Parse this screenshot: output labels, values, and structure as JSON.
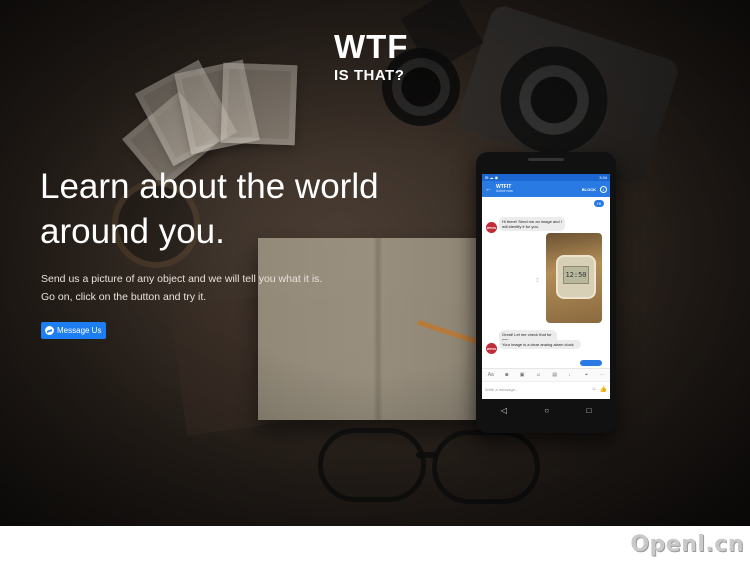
{
  "logo": {
    "main": "WTF",
    "sub": "IS THAT?"
  },
  "hero": {
    "headline_line1": "Learn about the world",
    "headline_line2": "around you.",
    "body_line1": "Send us a picture of any object and we will tell you what it is.",
    "body_line2": "Go on, click on the button and try it.",
    "cta_label": "Message Us",
    "cta_icon": "messenger-icon"
  },
  "phone": {
    "status_time": "3:34",
    "app_title": "WTFIT",
    "app_subtitle": "Active now",
    "block_label": "BLOCK",
    "back_icon": "arrow-left-icon",
    "info_icon": "info-icon",
    "user_badge": "Hi",
    "bot_avatar": "WTFIS",
    "greeting": "Hi there! Send me an image and I will identify it for you.",
    "photo_clock_time": "12:50",
    "reply_check": "Great! Let me check that for you...",
    "reply_result": "Your image is a clear analog alarm clock",
    "input_placeholder": "Write a message...",
    "toolbar_icons": [
      "text-icon",
      "camera-icon",
      "image-icon",
      "sticker-icon",
      "gif-icon",
      "mic-icon",
      "location-icon",
      "more-icon"
    ],
    "nav": {
      "back": "◁",
      "home": "○",
      "recent": "□"
    }
  },
  "colors": {
    "accent": "#1d7df2",
    "messenger_blue": "#2a7ae4",
    "avatar_red": "#c22d3a"
  },
  "watermark": "Openl.cn"
}
